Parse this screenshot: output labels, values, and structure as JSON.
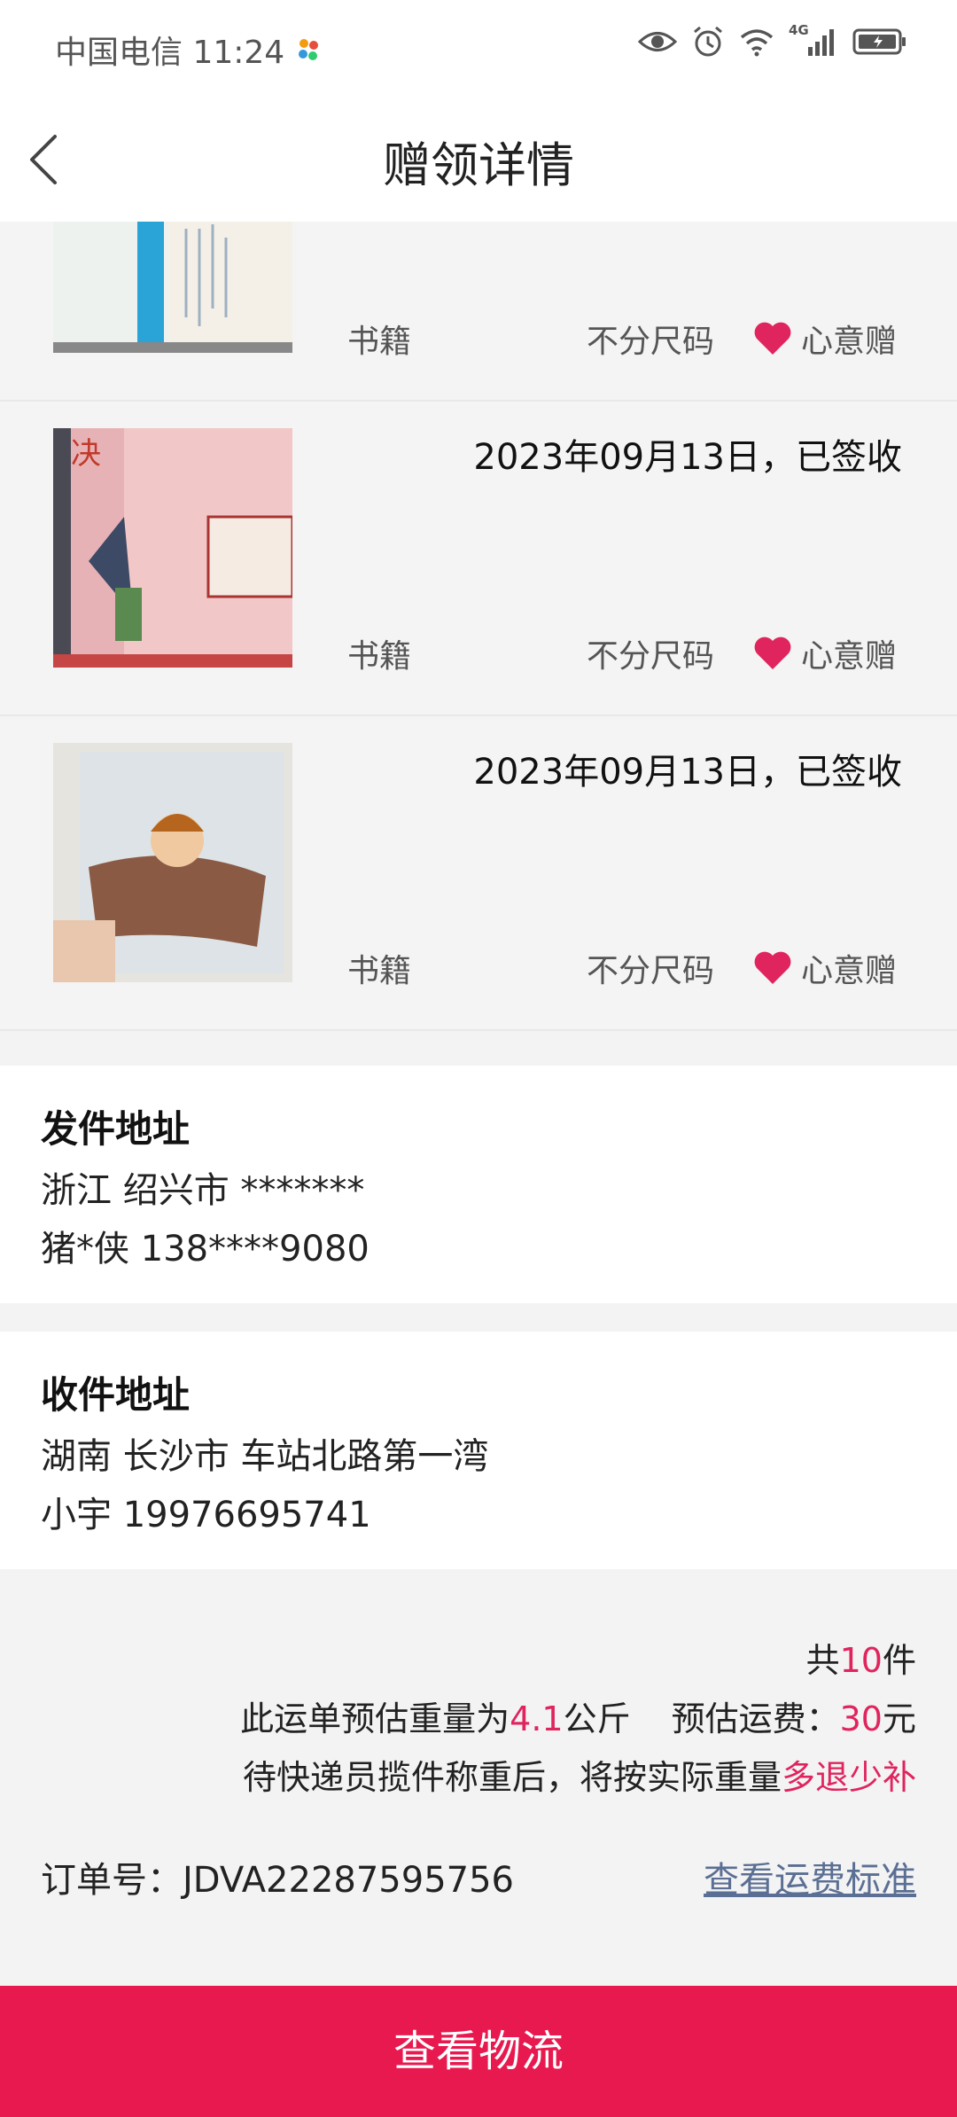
{
  "status_bar": {
    "carrier_time": "中国电信 11:24",
    "network_label": "4G"
  },
  "header": {
    "title": "赠领详情"
  },
  "items": [
    {
      "category": "书籍",
      "size": "不分尺码",
      "gift": "心意赠",
      "date": ""
    },
    {
      "category": "书籍",
      "size": "不分尺码",
      "gift": "心意赠",
      "date": "2023年09月13日，已签收"
    },
    {
      "category": "书籍",
      "size": "不分尺码",
      "gift": "心意赠",
      "date": "2023年09月13日，已签收"
    }
  ],
  "sender": {
    "title": "发件地址",
    "region": "浙江 绍兴市 *******",
    "contact": "猪*侠 138****9080"
  },
  "receiver": {
    "title": "收件地址",
    "region": "湖南 长沙市 车站北路第一湾",
    "contact": "小宇 19976695741"
  },
  "summary": {
    "count_prefix": "共",
    "count": "10",
    "count_suffix": "件",
    "weight_prefix": "此运单预估重量为",
    "weight": "4.1",
    "weight_unit": "公斤",
    "fee_prefix": "预估运费：",
    "fee": "30",
    "fee_unit": "元",
    "notice_prefix": "待快递员揽件称重后，将按实际重量",
    "notice_highlight": "多退少补",
    "order_no": "订单号：JDVA22287595756",
    "rate_link": "查看运费标准"
  },
  "bottom_button": "查看物流",
  "colors": {
    "accent": "#e8194f",
    "highlight": "#e0245e",
    "link": "#5b6f94"
  }
}
